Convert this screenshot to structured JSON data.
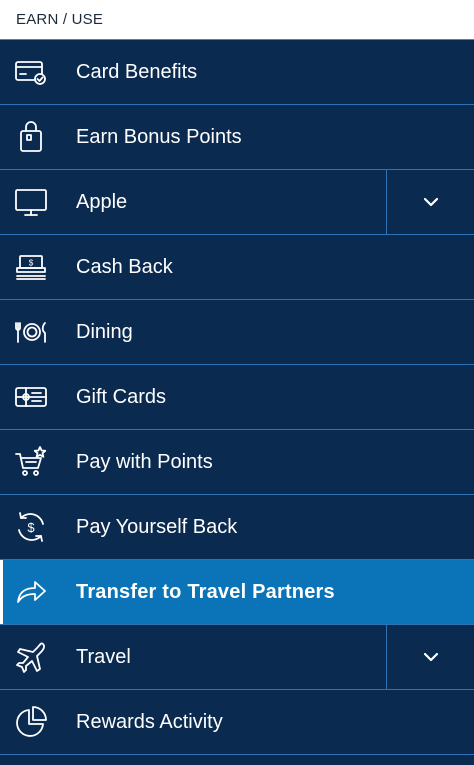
{
  "header": {
    "title": "EARN / USE"
  },
  "menu": {
    "items": [
      {
        "label": "Card Benefits",
        "icon": "credit-card-check-icon"
      },
      {
        "label": "Earn Bonus Points",
        "icon": "shopping-bag-icon"
      },
      {
        "label": "Apple",
        "icon": "desktop-monitor-icon",
        "expandable": true
      },
      {
        "label": "Cash Back",
        "icon": "cash-stack-icon"
      },
      {
        "label": "Dining",
        "icon": "plate-utensils-icon"
      },
      {
        "label": "Gift Cards",
        "icon": "gift-card-icon"
      },
      {
        "label": "Pay with Points",
        "icon": "cart-star-icon"
      },
      {
        "label": "Pay Yourself Back",
        "icon": "dollar-cycle-icon"
      },
      {
        "label": "Transfer to Travel Partners",
        "icon": "share-arrow-icon",
        "active": true
      },
      {
        "label": "Travel",
        "icon": "airplane-icon",
        "expandable": true
      },
      {
        "label": "Rewards Activity",
        "icon": "pie-chart-icon"
      }
    ]
  },
  "colors": {
    "background": "#0b2a4f",
    "active": "#0b74b8",
    "divider": "#2f73b6"
  }
}
